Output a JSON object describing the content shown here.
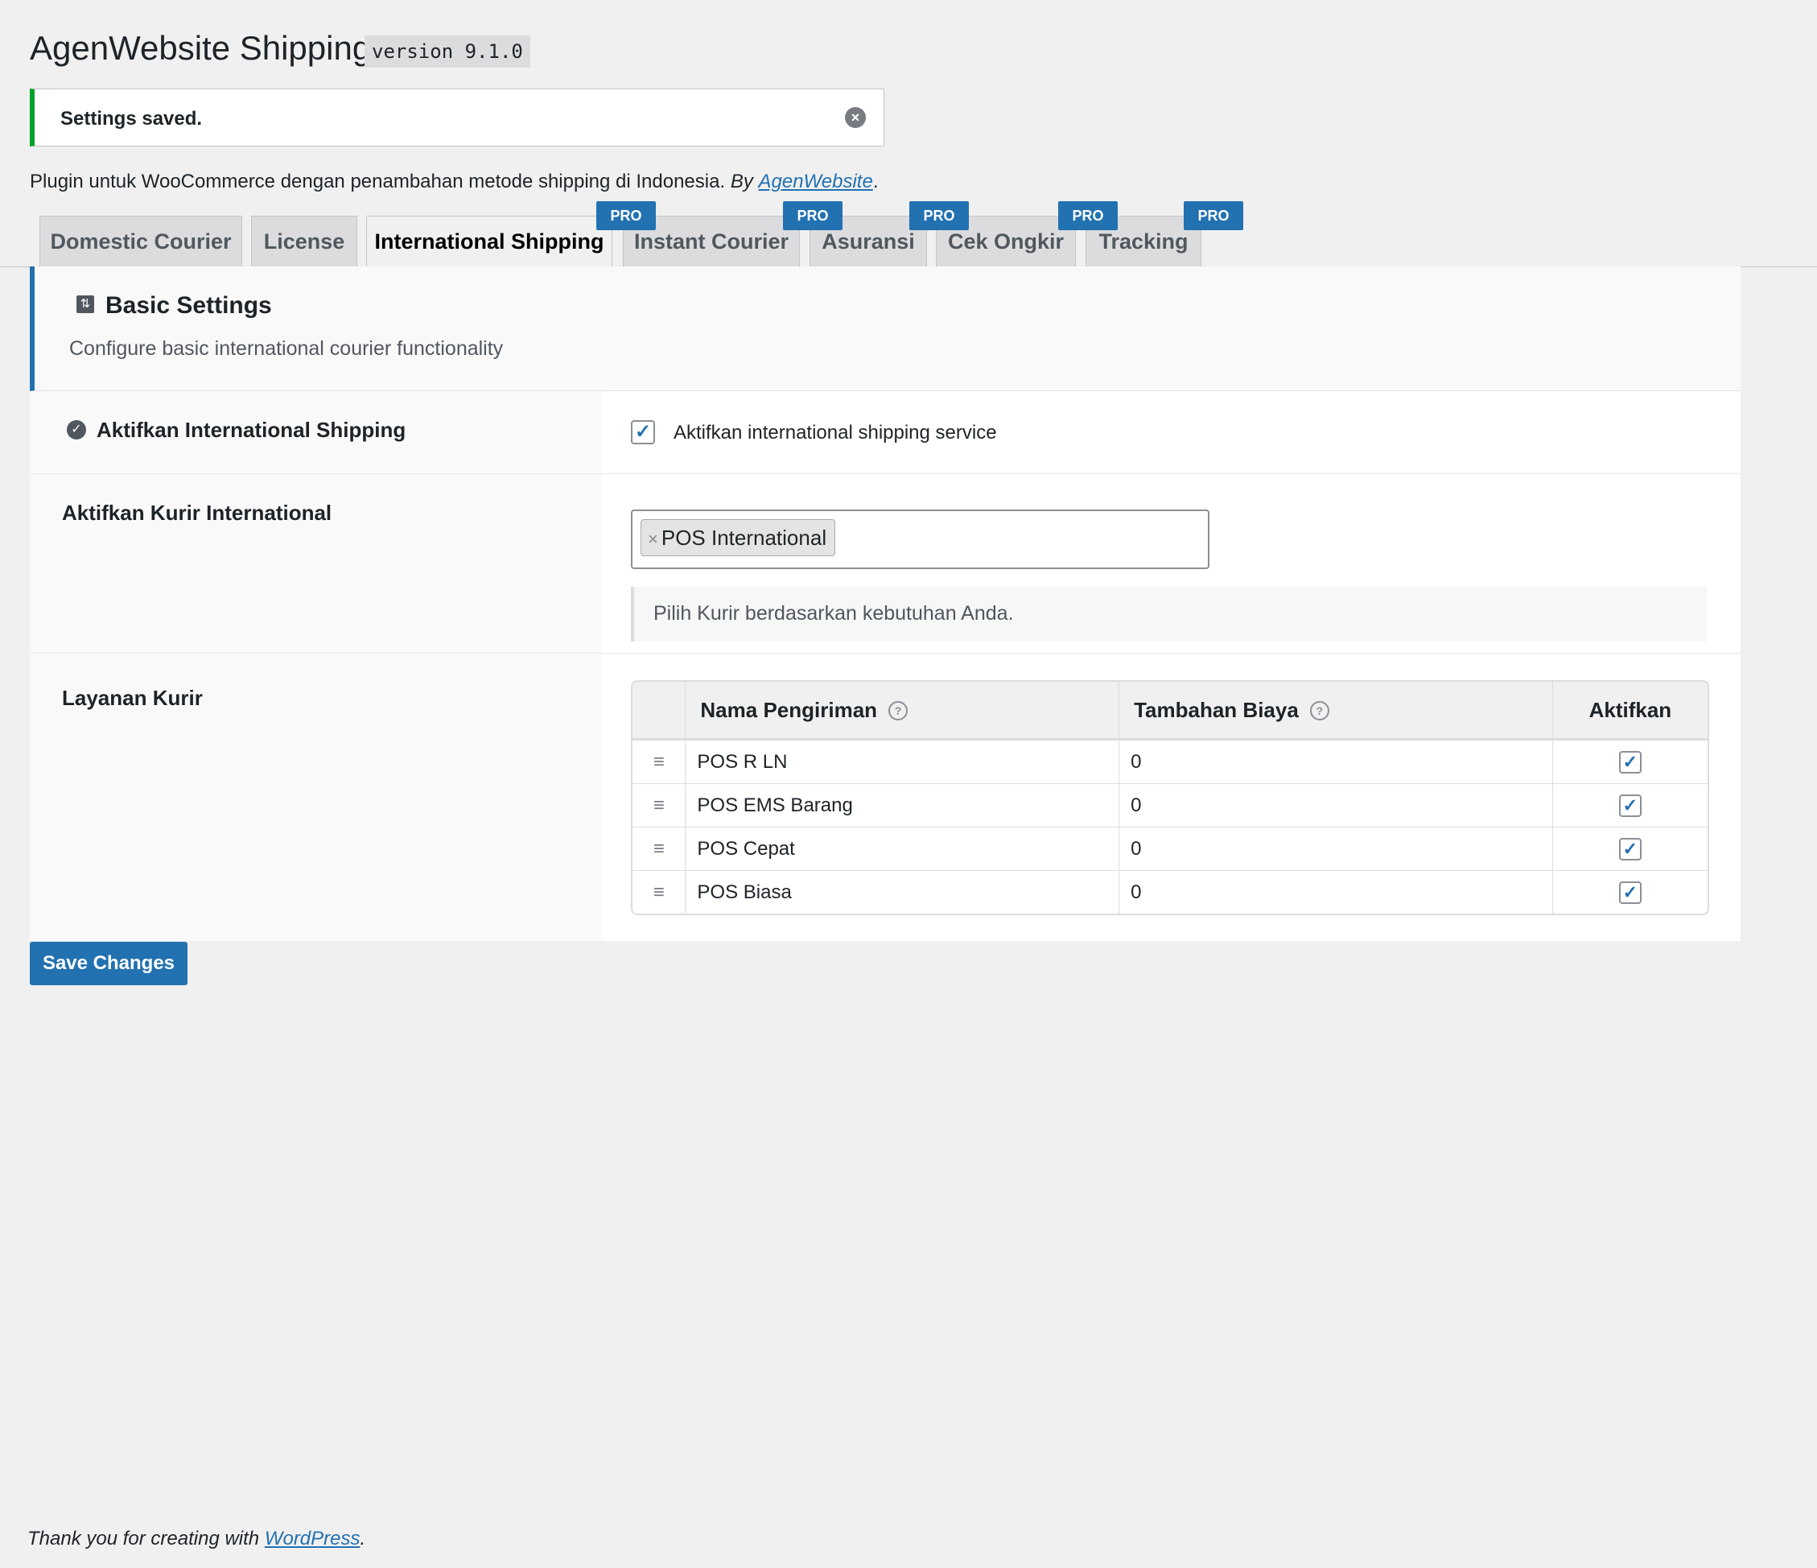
{
  "header": {
    "title": "AgenWebsite Shipping",
    "version": "version 9.1.0"
  },
  "notice": {
    "text": "Settings saved.",
    "close_icon": "×"
  },
  "description": {
    "text": "Plugin untuk WooCommerce dengan penambahan metode shipping di Indonesia.",
    "by": "By",
    "link": "AgenWebsite",
    "end": "."
  },
  "tabs": [
    {
      "label": "Domestic Courier"
    },
    {
      "label": "License"
    },
    {
      "label": "International Shipping"
    },
    {
      "label": "Instant Courier"
    },
    {
      "label": "Asuransi"
    },
    {
      "label": "Cek Ongkir"
    },
    {
      "label": "Tracking"
    }
  ],
  "pro_badge": "PRO",
  "basic_settings": {
    "title": "Basic Settings",
    "subtitle": "Configure basic international courier functionality"
  },
  "fields": {
    "enable": {
      "label": "Aktifkan International Shipping",
      "checkbox_label": "Aktifkan international shipping service",
      "checked": true
    },
    "couriers": {
      "label": "Aktifkan Kurir International",
      "selected": "POS International",
      "hint": "Pilih Kurir berdasarkan kebutuhan Anda."
    },
    "services": {
      "label": "Layanan Kurir",
      "columns": {
        "name": "Nama Pengiriman",
        "fee": "Tambahan Biaya",
        "active": "Aktifkan"
      },
      "rows": [
        {
          "name": "POS R LN",
          "fee": "0",
          "active": true
        },
        {
          "name": "POS EMS Barang",
          "fee": "0",
          "active": true
        },
        {
          "name": "POS Cepat",
          "fee": "0",
          "active": true
        },
        {
          "name": "POS Biasa",
          "fee": "0",
          "active": true
        }
      ]
    }
  },
  "save_button": "Save Changes",
  "footer": {
    "text": "Thank you for creating with",
    "link": "WordPress",
    "end": "."
  },
  "colors": {
    "accent": "#2271b1",
    "success": "#00a32a",
    "background": "#f0f0f1"
  }
}
